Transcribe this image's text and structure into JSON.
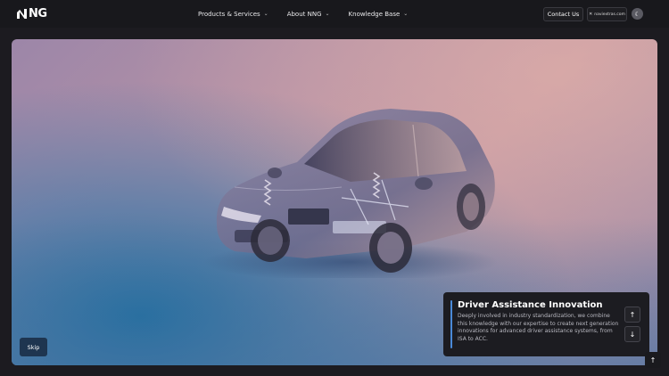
{
  "brand": {
    "logo_text": "NG"
  },
  "nav": {
    "items": [
      {
        "label": "Products & Services"
      },
      {
        "label": "About NNG"
      },
      {
        "label": "Knowledge Base"
      }
    ],
    "contact_label": "Contact Us",
    "site_label": "naviextras.com",
    "theme_icon": "moon-icon"
  },
  "hero": {
    "card": {
      "title": "Driver Assistance Innovation",
      "description": "Deeply involved in industry standardization, we combine this knowledge with our expertise to create next generation innovations for advanced driver assistance systems, from ISA to ACC."
    },
    "skip_label": "Skip",
    "accent_color": "#4a8ad8"
  },
  "icons": {
    "prev": "arrow-up-icon",
    "next": "arrow-down-icon",
    "back_to_top": "arrow-up-icon"
  }
}
